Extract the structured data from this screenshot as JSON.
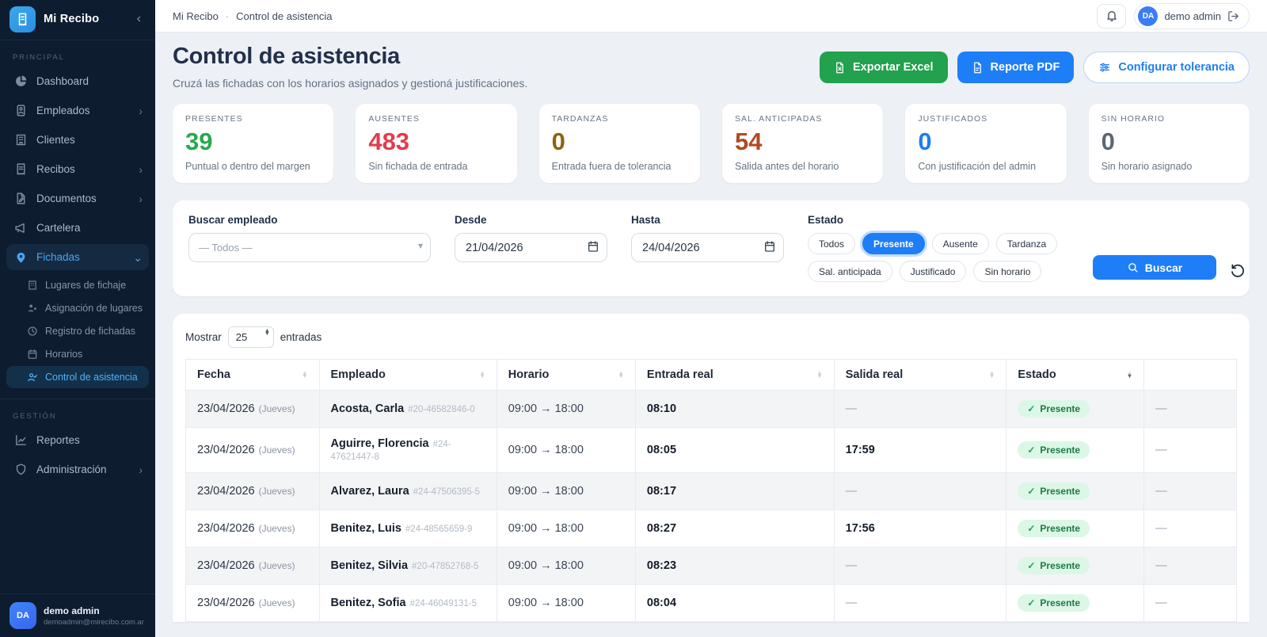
{
  "icons": {
    "chevron_left": "‹",
    "chevron_right": "›",
    "chevron_down": "⌄",
    "check": "✓",
    "sort_asc": "▲",
    "sort_desc": "▼",
    "caret": "▾"
  },
  "colors": {
    "accent_blue": "#1e7ef7",
    "excel_green": "#22a14e",
    "sidebar_bg": "#0d1c2f",
    "present_green": "#26a94f",
    "absent_red": "#e23c4f",
    "late_amber": "#8a6410",
    "early_brick": "#b14a23",
    "justified_blue": "#1b7ef2",
    "noschedule_gray": "#5d6772",
    "badge_bg": "#dcf7e6"
  },
  "sidebar": {
    "brand": "Mi Recibo",
    "sections": {
      "principal": "PRINCIPAL",
      "gestion": "GESTIÓN"
    },
    "items": [
      {
        "label": "Dashboard"
      },
      {
        "label": "Empleados"
      },
      {
        "label": "Clientes"
      },
      {
        "label": "Recibos"
      },
      {
        "label": "Documentos"
      },
      {
        "label": "Cartelera"
      },
      {
        "label": "Fichadas"
      }
    ],
    "fichadas_submenu": [
      {
        "label": "Lugares de fichaje"
      },
      {
        "label": "Asignación de lugares"
      },
      {
        "label": "Registro de fichadas"
      },
      {
        "label": "Horarios"
      },
      {
        "label": "Control de asistencia"
      }
    ],
    "gestion_items": [
      {
        "label": "Reportes"
      },
      {
        "label": "Administración"
      }
    ],
    "user": {
      "initials": "DA",
      "name": "demo admin",
      "email": "demoadmin@mirecibo.com.ar"
    }
  },
  "topbar": {
    "breadcrumb_app": "Mi Recibo",
    "separator": "·",
    "breadcrumb_page": "Control de asistencia",
    "user_initials": "DA",
    "user_name": "demo admin"
  },
  "header": {
    "title": "Control de asistencia",
    "subtitle": "Cruzá las fichadas con los horarios asignados y gestioná justificaciones.",
    "export_excel": "Exportar Excel",
    "report_pdf": "Reporte PDF",
    "configure_tolerance": "Configurar tolerancia"
  },
  "stats": [
    {
      "label": "PRESENTES",
      "value": "39",
      "caption": "Puntual o dentro del margen"
    },
    {
      "label": "AUSENTES",
      "value": "483",
      "caption": "Sin fichada de entrada"
    },
    {
      "label": "TARDANZAS",
      "value": "0",
      "caption": "Entrada fuera de tolerancia"
    },
    {
      "label": "SAL. ANTICIPADAS",
      "value": "54",
      "caption": "Salida antes del horario"
    },
    {
      "label": "JUSTIFICADOS",
      "value": "0",
      "caption": "Con justificación del admin"
    },
    {
      "label": "SIN HORARIO",
      "value": "0",
      "caption": "Sin horario asignado"
    }
  ],
  "filters": {
    "buscar_label": "Buscar empleado",
    "buscar_value": "— Todos —",
    "desde_label": "Desde",
    "desde_value": "21/04/2026",
    "hasta_label": "Hasta",
    "hasta_value": "24/04/2026",
    "estado_label": "Estado",
    "chips": [
      {
        "label": "Todos"
      },
      {
        "label": "Presente",
        "active": true
      },
      {
        "label": "Ausente"
      },
      {
        "label": "Tardanza"
      },
      {
        "label": "Sal. anticipada"
      },
      {
        "label": "Justificado"
      },
      {
        "label": "Sin horario"
      }
    ],
    "buscar_button": "Buscar"
  },
  "table": {
    "mostrar": "Mostrar",
    "page_size": "25",
    "entradas": "entradas",
    "columns": [
      "Fecha",
      "Empleado",
      "Horario",
      "Entrada real",
      "Salida real",
      "Estado"
    ],
    "rows": [
      {
        "fecha": "23/04/2026",
        "dia": "(Jueves)",
        "nombre": "Acosta, Carla",
        "cuil": "#20-46582846-0",
        "horario": "09:00 → 18:00",
        "entrada": "08:10",
        "salida": "—",
        "estado": "Presente",
        "acciones": "—"
      },
      {
        "fecha": "23/04/2026",
        "dia": "(Jueves)",
        "nombre": "Aguirre, Florencia",
        "cuil": "#24-47621447-8",
        "horario": "09:00 → 18:00",
        "entrada": "08:05",
        "salida": "17:59",
        "estado": "Presente",
        "acciones": "—"
      },
      {
        "fecha": "23/04/2026",
        "dia": "(Jueves)",
        "nombre": "Alvarez, Laura",
        "cuil": "#24-47506395-5",
        "horario": "09:00 → 18:00",
        "entrada": "08:17",
        "salida": "—",
        "estado": "Presente",
        "acciones": "—"
      },
      {
        "fecha": "23/04/2026",
        "dia": "(Jueves)",
        "nombre": "Benitez, Luis",
        "cuil": "#24-48565659-9",
        "horario": "09:00 → 18:00",
        "entrada": "08:27",
        "salida": "17:56",
        "estado": "Presente",
        "acciones": "—"
      },
      {
        "fecha": "23/04/2026",
        "dia": "(Jueves)",
        "nombre": "Benitez, Silvia",
        "cuil": "#20-47852768-5",
        "horario": "09:00 → 18:00",
        "entrada": "08:23",
        "salida": "—",
        "estado": "Presente",
        "acciones": "—"
      },
      {
        "fecha": "23/04/2026",
        "dia": "(Jueves)",
        "nombre": "Benitez, Sofia",
        "cuil": "#24-46049131-5",
        "horario": "09:00 → 18:00",
        "entrada": "08:04",
        "salida": "—",
        "estado": "Presente",
        "acciones": "—"
      }
    ]
  }
}
